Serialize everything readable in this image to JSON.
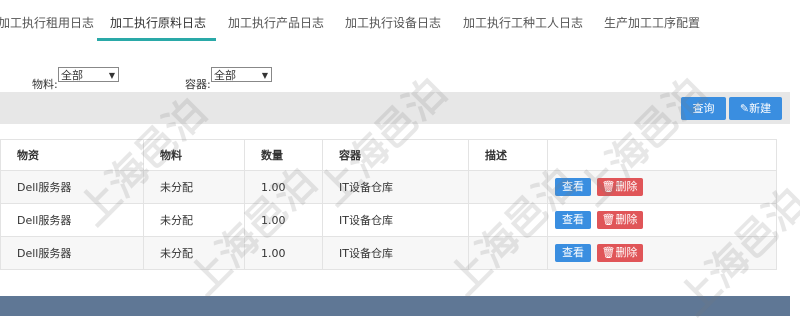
{
  "tabs": [
    {
      "label": "加工执行租用日志"
    },
    {
      "label": "加工执行原料日志"
    },
    {
      "label": "加工执行产品日志"
    },
    {
      "label": "加工执行设备日志"
    },
    {
      "label": "加工执行工种工人日志"
    },
    {
      "label": "生产加工工序配置"
    }
  ],
  "filters": {
    "material_label": "物料:",
    "material_value": "全部",
    "container_label": "容器:",
    "container_value": "全部"
  },
  "toolbar": {
    "query_label": "查询",
    "new_label": "新建"
  },
  "table": {
    "headers": [
      "物资",
      "物料",
      "数量",
      "容器",
      "描述",
      ""
    ],
    "rows": [
      {
        "goods": "Dell服务器",
        "material": "未分配",
        "qty": "1.00",
        "container": "IT设备仓库",
        "desc": "",
        "view": "查看",
        "delete": "删除"
      },
      {
        "goods": "Dell服务器",
        "material": "未分配",
        "qty": "1.00",
        "container": "IT设备仓库",
        "desc": "",
        "view": "查看",
        "delete": "删除"
      },
      {
        "goods": "Dell服务器",
        "material": "未分配",
        "qty": "1.00",
        "container": "IT设备仓库",
        "desc": "",
        "view": "查看",
        "delete": "删除"
      }
    ]
  },
  "watermark": "上海邑泊",
  "colors": {
    "accent": "#2aa9a8",
    "primary": "#3a8ee0",
    "danger": "#e05558",
    "footer": "#5f7795"
  }
}
